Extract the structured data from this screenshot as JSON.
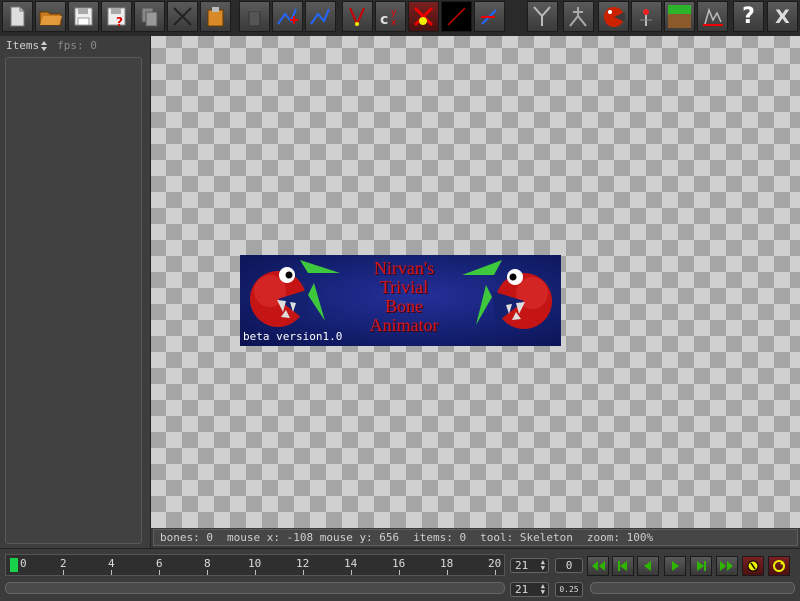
{
  "toolbar": {
    "buttons": [
      {
        "name": "new-file-icon"
      },
      {
        "name": "open-folder-icon"
      },
      {
        "name": "save-icon"
      },
      {
        "name": "save-as-icon"
      },
      {
        "name": "copy-icon"
      },
      {
        "name": "bone-tool-icon"
      },
      {
        "name": "paste-icon"
      },
      {
        "name": "delete-icon"
      },
      {
        "name": "add-bone-icon"
      },
      {
        "name": "edit-bones-icon"
      },
      {
        "name": "pin-tool-icon"
      },
      {
        "name": "coordinates-icon"
      },
      {
        "name": "remove-tool-icon"
      },
      {
        "name": "line-tool-icon"
      },
      {
        "name": "rotate-bone-icon"
      },
      {
        "name": "skeleton-icon"
      },
      {
        "name": "skeleton-alt-icon"
      },
      {
        "name": "sprite-icon"
      },
      {
        "name": "pin-icon"
      },
      {
        "name": "ground-icon"
      },
      {
        "name": "graph-icon"
      },
      {
        "name": "help-icon",
        "label": "?"
      },
      {
        "name": "close-icon",
        "label": "X"
      }
    ]
  },
  "left_panel": {
    "items_label": "Items",
    "fps_label": "fps: 0"
  },
  "banner": {
    "title": "Nirvan's\nTrivial\nBone\nAnimator",
    "version": "beta version1.0"
  },
  "status": {
    "bones": "bones: 0",
    "mouse_x": "mouse x: -108",
    "mouse_y": "mouse y: 656",
    "items": "items: 0",
    "tool": "tool: Skeleton",
    "zoom": "zoom: 100%"
  },
  "timeline": {
    "current_marker": "0",
    "ticks": [
      "2",
      "4",
      "6",
      "8",
      "10",
      "12",
      "14",
      "16",
      "18",
      "20"
    ],
    "total_frames": "21",
    "total_frames_2": "21",
    "current_frame": "0",
    "speed": "0.25",
    "position_fraction": 0.0
  },
  "colors": {
    "accent": "#18d24a",
    "banner_text": "#d6161e",
    "play_green": "#2fb400"
  },
  "playback": [
    {
      "name": "first-frame-icon"
    },
    {
      "name": "prev-keyframe-icon"
    },
    {
      "name": "prev-frame-icon"
    },
    {
      "name": "play-icon"
    },
    {
      "name": "next-frame-icon"
    },
    {
      "name": "last-frame-icon"
    },
    {
      "name": "record-icon"
    },
    {
      "name": "loop-icon"
    }
  ]
}
